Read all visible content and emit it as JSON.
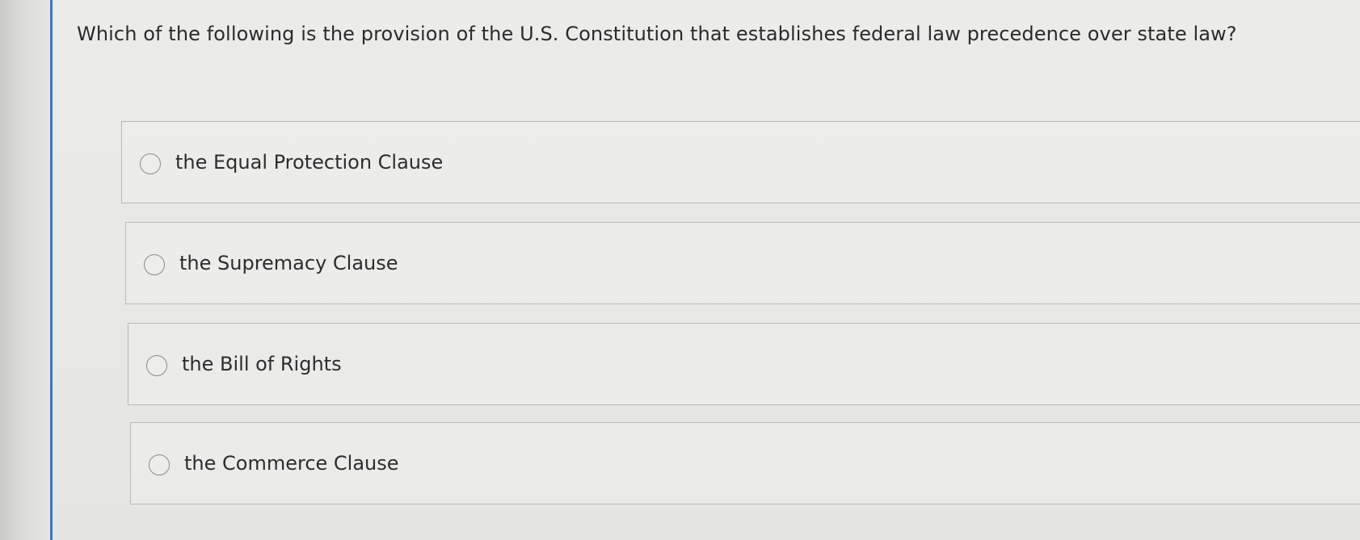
{
  "question": {
    "text": "Which of the following is the provision of the U.S. Constitution that establishes federal law precedence over state law?"
  },
  "options": [
    {
      "label": "the Equal Protection Clause"
    },
    {
      "label": "the Supremacy Clause"
    },
    {
      "label": "the Bill of Rights"
    },
    {
      "label": "the Commerce Clause"
    }
  ],
  "colors": {
    "accent_edge": "#3b76c4",
    "background": "#e9e9e7",
    "text": "#2b2b2b",
    "border": "#b9b9b7"
  },
  "icons": {
    "radio": "radio-button-icon"
  }
}
